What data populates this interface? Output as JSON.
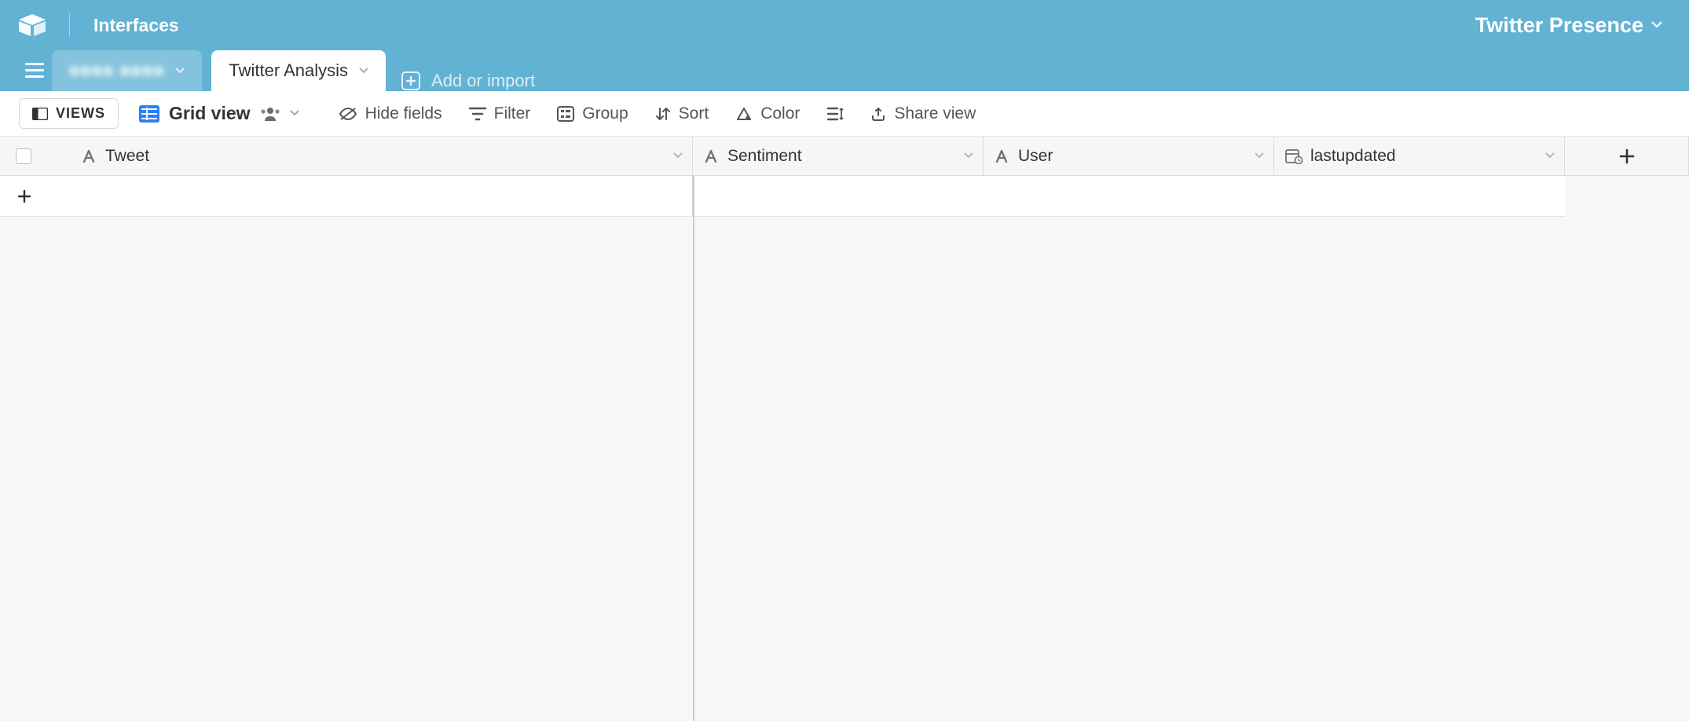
{
  "header": {
    "interfaces_label": "Interfaces",
    "base_name": "Twitter Presence"
  },
  "tabs": {
    "inactive_blurred": "■■■■ ■■■■",
    "active": "Twitter Analysis",
    "add_import": "Add or import"
  },
  "toolbar": {
    "views": "VIEWS",
    "grid_view": "Grid view",
    "hide_fields": "Hide fields",
    "filter": "Filter",
    "group": "Group",
    "sort": "Sort",
    "color": "Color",
    "share_view": "Share view"
  },
  "columns": {
    "tweet": "Tweet",
    "sentiment": "Sentiment",
    "user": "User",
    "lastupdated": "lastupdated"
  }
}
